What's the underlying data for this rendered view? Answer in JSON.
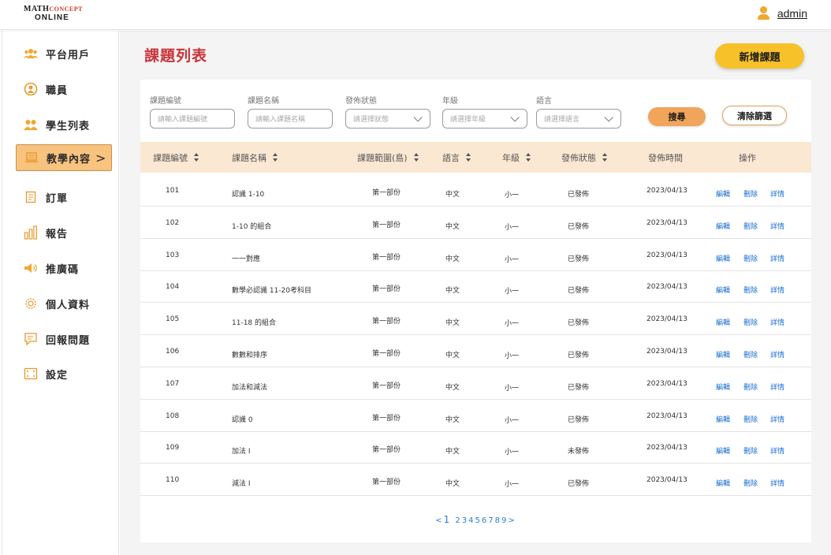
{
  "brand": {
    "line1_main": "MATH",
    "line1_accent": "CONCEPT",
    "line2": "ONLINE"
  },
  "user": {
    "name": "admin",
    "icon": "user-icon"
  },
  "sidebar": {
    "items": [
      {
        "label": "平台用戶",
        "icon": "users-group-icon"
      },
      {
        "label": "職員",
        "icon": "staff-icon"
      },
      {
        "label": "學生列表",
        "icon": "students-icon"
      },
      {
        "label": "教學內容",
        "icon": "teaching-content-icon",
        "active": true,
        "chevron": ">"
      },
      {
        "label": "訂單",
        "icon": "order-icon"
      },
      {
        "label": "報告",
        "icon": "report-chart-icon"
      },
      {
        "label": "推廣碼",
        "icon": "megaphone-icon"
      },
      {
        "label": "個人資料",
        "icon": "gear-icon"
      },
      {
        "label": "回報問題",
        "icon": "report-issue-icon"
      },
      {
        "label": "設定",
        "icon": "settings-icon"
      }
    ]
  },
  "page": {
    "title": "課題列表",
    "add_button": "新增課題"
  },
  "filters": [
    {
      "label": "課題編號",
      "placeholder": "請輸入課題編號",
      "type": "text"
    },
    {
      "label": "課題名稱",
      "placeholder": "請輸入課題名稱",
      "type": "text"
    },
    {
      "label": "發佈狀態",
      "placeholder": "請選擇狀態",
      "type": "select"
    },
    {
      "label": "年級",
      "placeholder": "請選擇年級",
      "type": "select"
    },
    {
      "label": "語言",
      "placeholder": "請選擇語言",
      "type": "select"
    }
  ],
  "buttons": {
    "search": "搜尋",
    "clear": "清除篩選"
  },
  "table": {
    "headers": [
      {
        "label": "課題編號",
        "sortable": true
      },
      {
        "label": "課題名稱",
        "sortable": true
      },
      {
        "label": "課題範圍(島)",
        "sortable": true
      },
      {
        "label": "語言",
        "sortable": true
      },
      {
        "label": "年級",
        "sortable": true
      },
      {
        "label": "發佈狀態",
        "sortable": true
      },
      {
        "label": "發佈時間",
        "sortable": false
      },
      {
        "label": "操作",
        "sortable": false
      }
    ],
    "actions": {
      "edit": "編輯",
      "delete": "刪除",
      "detail": "詳情"
    },
    "rows": [
      {
        "id": "101",
        "name": "認識 1-10",
        "scope": "第一部份",
        "lang": "中文",
        "grade": "小一",
        "status": "已發佈",
        "date": "2023/04/13"
      },
      {
        "id": "102",
        "name": "1-10 的組合",
        "scope": "第一部份",
        "lang": "中文",
        "grade": "小一",
        "status": "已發佈",
        "date": "2023/04/13"
      },
      {
        "id": "103",
        "name": "一一對應",
        "scope": "第一部份",
        "lang": "中文",
        "grade": "小一",
        "status": "已發佈",
        "date": "2023/04/13"
      },
      {
        "id": "104",
        "name": "數學必認識 11-20考科目",
        "scope": "第一部份",
        "lang": "中文",
        "grade": "小一",
        "status": "已發佈",
        "date": "2023/04/13"
      },
      {
        "id": "105",
        "name": "11-18 的組合",
        "scope": "第一部份",
        "lang": "中文",
        "grade": "小一",
        "status": "已發佈",
        "date": "2023/04/13"
      },
      {
        "id": "106",
        "name": "數數和排序",
        "scope": "第一部份",
        "lang": "中文",
        "grade": "小一",
        "status": "已發佈",
        "date": "2023/04/13"
      },
      {
        "id": "107",
        "name": "加法和減法",
        "scope": "第一部份",
        "lang": "中文",
        "grade": "小一",
        "status": "已發佈",
        "date": "2023/04/13"
      },
      {
        "id": "108",
        "name": "認識 0",
        "scope": "第一部份",
        "lang": "中文",
        "grade": "小一",
        "status": "已發佈",
        "date": "2023/04/13"
      },
      {
        "id": "109",
        "name": "加法 I",
        "scope": "第一部份",
        "lang": "中文",
        "grade": "小一",
        "status": "未發佈",
        "date": "2023/04/13"
      },
      {
        "id": "110",
        "name": "減法 I",
        "scope": "第一部份",
        "lang": "中文",
        "grade": "小一",
        "status": "已發佈",
        "date": "2023/04/13"
      }
    ]
  },
  "pagination": {
    "prev": "<",
    "next": ">",
    "current": "1",
    "pages": [
      "2",
      "3",
      "4",
      "5",
      "6",
      "7",
      "8",
      "9"
    ]
  },
  "colors": {
    "accent": "#f7c12a",
    "title": "#c8343a",
    "header_bg": "#fbe8d3",
    "link": "#1a6fd0",
    "active_nav": "#f7c37e"
  }
}
